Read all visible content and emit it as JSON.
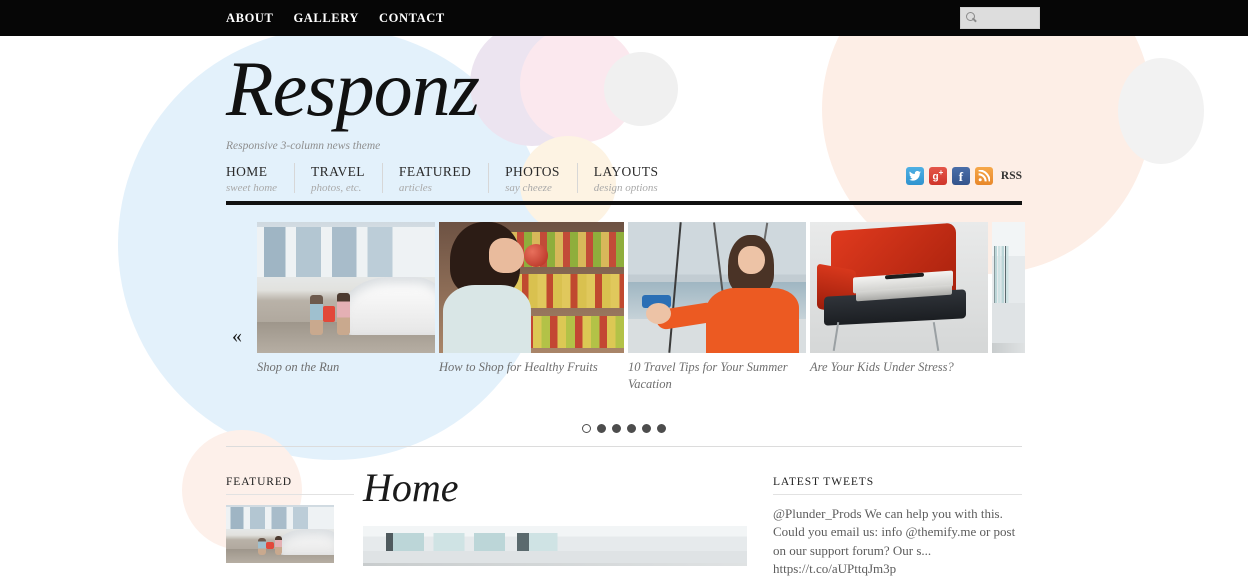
{
  "topbar": {
    "nav": [
      {
        "label": "ABOUT"
      },
      {
        "label": "GALLERY"
      },
      {
        "label": "CONTACT"
      }
    ],
    "search": {
      "value": "",
      "placeholder": ""
    }
  },
  "header": {
    "logo": "Responz",
    "tagline": "Responsive 3-column news theme"
  },
  "menu": [
    {
      "title": "HOME",
      "sub": "sweet home"
    },
    {
      "title": "TRAVEL",
      "sub": "photos, etc."
    },
    {
      "title": "FEATURED",
      "sub": "articles"
    },
    {
      "title": "PHOTOS",
      "sub": "say cheeze"
    },
    {
      "title": "LAYOUTS",
      "sub": "design options"
    }
  ],
  "social": {
    "twitter": "t",
    "googleplus": "g+",
    "facebook": "f",
    "rss_glyph": "r",
    "rss_label": "RSS",
    "colors": {
      "twitter": "#3f9fd8",
      "googleplus": "#d93b2f",
      "facebook": "#3c5b97",
      "rss": "#ee943a"
    }
  },
  "slider": {
    "prev": "«",
    "next": "»",
    "slides": [
      {
        "caption": "Shop on the Run"
      },
      {
        "caption": "How to Shop for Healthy Fruits"
      },
      {
        "caption": "10 Travel Tips for Your Summer Vacation"
      },
      {
        "caption": "Are Your Kids Under Stress?"
      }
    ],
    "dots": [
      {
        "active": true
      },
      {
        "active": false
      },
      {
        "active": false
      },
      {
        "active": false
      },
      {
        "active": false
      },
      {
        "active": false
      }
    ]
  },
  "columns": {
    "left": {
      "heading": "FEATURED"
    },
    "middle": {
      "title": "Home"
    },
    "right": {
      "heading": "LATEST TWEETS",
      "tweet": "@Plunder_Prods We can help you with this. Could you email us: info @themify.me or post on our support forum? Our s... https://t.co/aUPttqJm3p"
    }
  }
}
